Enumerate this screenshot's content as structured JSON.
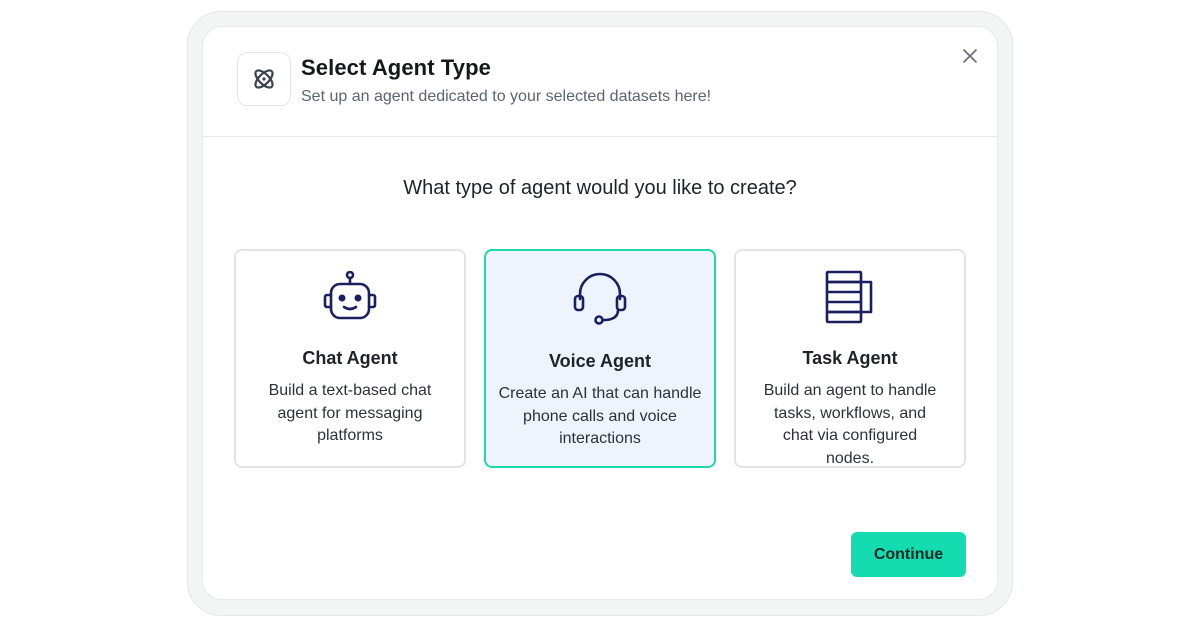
{
  "dialog": {
    "title": "Select Agent Type",
    "subtitle": "Set up an agent dedicated to your selected datasets here!",
    "header_icon": "atom-icon",
    "close_icon": "close-icon"
  },
  "question": "What type of agent would you like to create?",
  "cards": [
    {
      "icon": "robot-icon",
      "title": "Chat Agent",
      "description": "Build a text-based chat agent for messaging platforms",
      "selected": false
    },
    {
      "icon": "headset-icon",
      "title": "Voice Agent",
      "description": "Create an AI that can handle phone calls and voice interactions",
      "selected": true
    },
    {
      "icon": "task-blocks-icon",
      "title": "Task Agent",
      "description": "Build an agent to handle tasks, workflows, and chat via configured nodes.",
      "selected": false
    }
  ],
  "actions": {
    "continue_label": "Continue"
  },
  "colors": {
    "accent": "#15dbb0",
    "selected_border": "#1fd6ad",
    "selected_bg": "#eef4fd",
    "icon_navy": "#1b1f5e"
  }
}
